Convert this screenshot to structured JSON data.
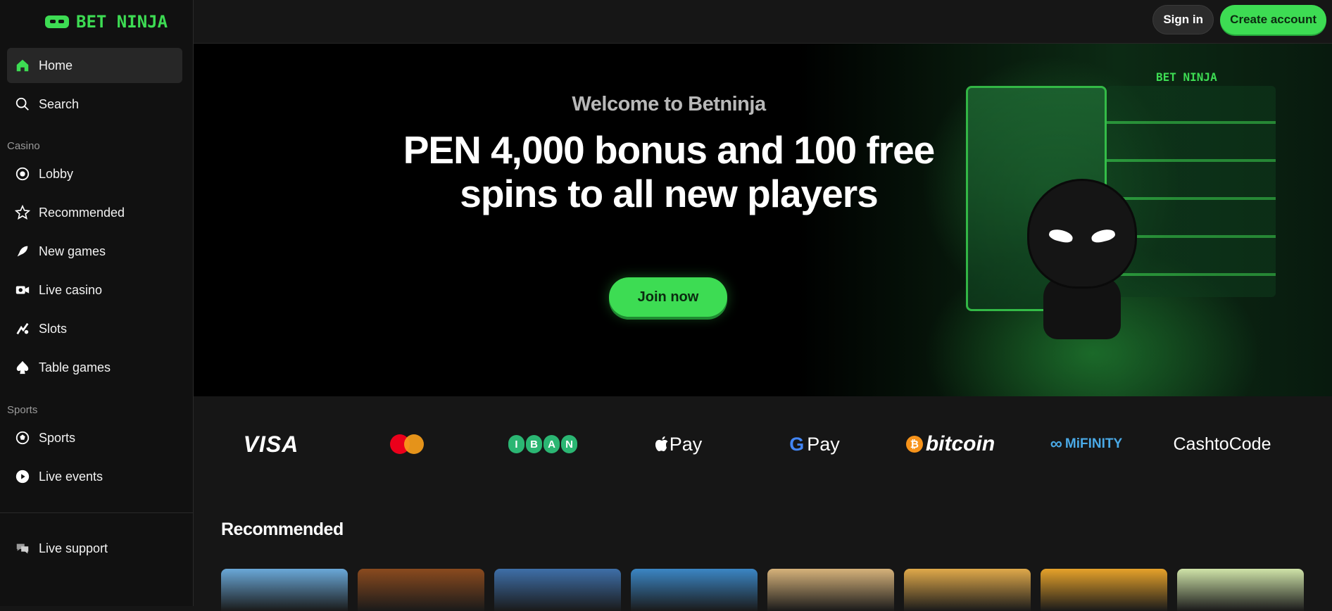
{
  "brand": {
    "name": "BET NINJA",
    "accent": "#3ddc53"
  },
  "header": {
    "signin_label": "Sign in",
    "create_label": "Create account"
  },
  "sidebar": {
    "items_top": [
      {
        "label": "Home",
        "icon": "home-icon"
      },
      {
        "label": "Search",
        "icon": "search-icon"
      }
    ],
    "casino_label": "Casino",
    "casino_items": [
      {
        "label": "Lobby",
        "icon": "lobby-icon"
      },
      {
        "label": "Recommended",
        "icon": "star-icon"
      },
      {
        "label": "New games",
        "icon": "rocket-icon"
      },
      {
        "label": "Live casino",
        "icon": "camera-icon"
      },
      {
        "label": "Slots",
        "icon": "slots-icon"
      },
      {
        "label": "Table games",
        "icon": "spade-icon"
      }
    ],
    "sports_label": "Sports",
    "sports_items": [
      {
        "label": "Sports",
        "icon": "ball-icon"
      },
      {
        "label": "Live events",
        "icon": "play-icon"
      }
    ],
    "support_label": "Live support"
  },
  "hero": {
    "welcome": "Welcome to Betninja",
    "headline": "PEN 4,000 bonus and 100 free spins to all new players",
    "cta": "Join now",
    "sign_text": "BET NINJA"
  },
  "payments": [
    "VISA",
    "mastercard",
    "IBAN",
    "Pay",
    "Pay",
    "bitcoin",
    "MiFINITY",
    "CashtoCode"
  ],
  "recommended": {
    "title": "Recommended",
    "tile_colors": [
      "#6aa8d8",
      "#8a4a1e",
      "#3e6fa8",
      "#3b86c4",
      "#d6b27a",
      "#e0a94a",
      "#e6a22a",
      "#cfe3a8"
    ]
  }
}
